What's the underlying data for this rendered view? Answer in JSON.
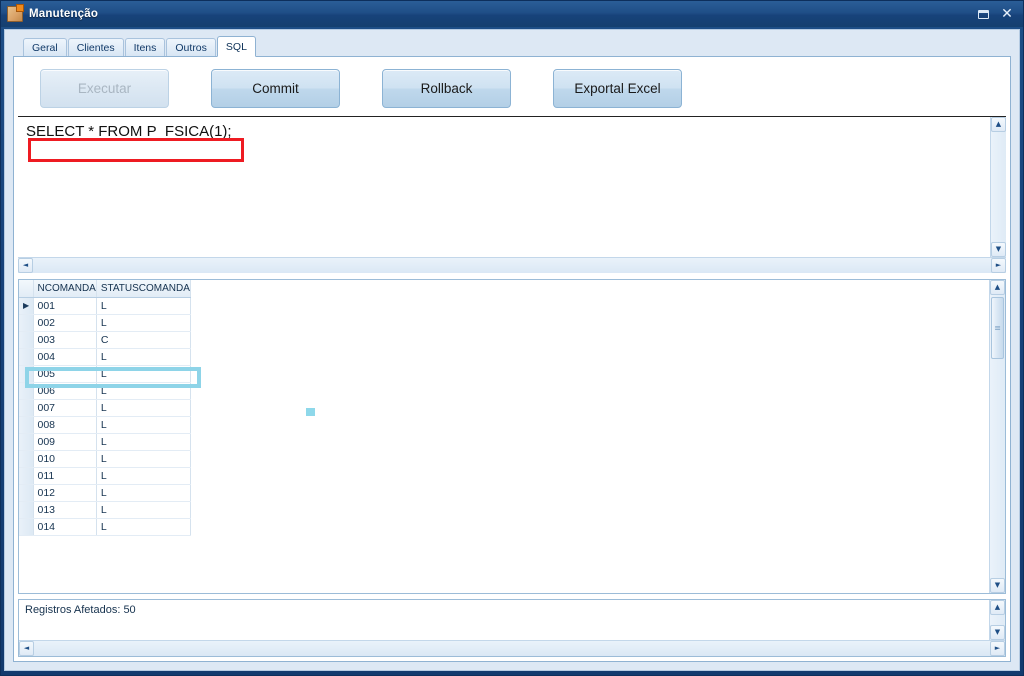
{
  "window": {
    "title": "Manutenção",
    "app_icon": "app-document-icon",
    "buttons": {
      "restore": "restore-window",
      "close": "✕"
    }
  },
  "tabs": [
    {
      "label": "Geral",
      "active": false
    },
    {
      "label": "Clientes",
      "active": false
    },
    {
      "label": "Itens",
      "active": false
    },
    {
      "label": "Outros",
      "active": false
    },
    {
      "label": "SQL",
      "active": true
    }
  ],
  "toolbar": {
    "executar_label": "Executar",
    "executar_enabled": false,
    "commit_label": "Commit",
    "rollback_label": "Rollback",
    "exportar_label": "Exportal Excel"
  },
  "sql_editor": {
    "query_text": "SELECT * FROM P_FSICA(1);",
    "highlight_color": "#ee1b22"
  },
  "grid": {
    "columns": [
      "NCOMANDA",
      "STATUSCOMANDA"
    ],
    "rows": [
      {
        "ncomanda": "001",
        "status": "L",
        "current": true
      },
      {
        "ncomanda": "002",
        "status": "L",
        "current": false
      },
      {
        "ncomanda": "003",
        "status": "C",
        "current": false
      },
      {
        "ncomanda": "004",
        "status": "L",
        "current": false
      },
      {
        "ncomanda": "005",
        "status": "L",
        "current": false
      },
      {
        "ncomanda": "006",
        "status": "L",
        "current": false
      },
      {
        "ncomanda": "007",
        "status": "L",
        "current": false
      },
      {
        "ncomanda": "008",
        "status": "L",
        "current": false
      },
      {
        "ncomanda": "009",
        "status": "L",
        "current": false
      },
      {
        "ncomanda": "010",
        "status": "L",
        "current": false
      },
      {
        "ncomanda": "011",
        "status": "L",
        "current": false
      },
      {
        "ncomanda": "012",
        "status": "L",
        "current": false
      },
      {
        "ncomanda": "013",
        "status": "L",
        "current": false
      },
      {
        "ncomanda": "014",
        "status": "L",
        "current": false
      }
    ],
    "row_indicator_glyph": "▶",
    "highlight_color": "#8ed4e8",
    "highlighted_row": "003"
  },
  "status": {
    "message": "Registros Afetados: 50"
  },
  "scrollbars": {
    "up_arrow": "▲",
    "down_arrow": "▼",
    "left_arrow": "◄",
    "right_arrow": "►"
  }
}
